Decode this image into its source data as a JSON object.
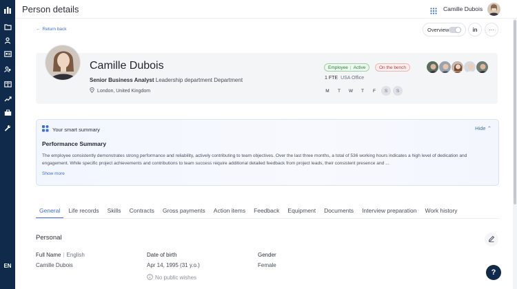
{
  "app": {
    "page_title": "Person details",
    "user_name": "Camille Dubois",
    "language": "EN"
  },
  "sidebar": {
    "icons": [
      "logo-icon",
      "folder-icon",
      "person-icon",
      "id-card-icon",
      "team-icon",
      "book-icon",
      "trend-icon",
      "briefcase-icon",
      "wrench-icon"
    ]
  },
  "header": {
    "return_label": "Return back",
    "overview_label": "Overview",
    "overview_on": false,
    "linkedin_label": "in",
    "more_label": "···"
  },
  "profile": {
    "name": "Camille Dubois",
    "title": "Senior Business Analyst",
    "department": "Leadership department Department",
    "location": "London, United Kingdom",
    "status_left": "Employee",
    "status_right": "Active",
    "bench_label": "On the bench",
    "fte": "1 FTE",
    "office": "USA Office",
    "days": [
      {
        "label": "M",
        "off": false
      },
      {
        "label": "T",
        "off": false
      },
      {
        "label": "W",
        "off": false
      },
      {
        "label": "T",
        "off": false
      },
      {
        "label": "F",
        "off": false
      },
      {
        "label": "S",
        "off": true
      },
      {
        "label": "S",
        "off": true
      }
    ]
  },
  "summary": {
    "header": "Your smart summary",
    "hide_label": "Hide",
    "title": "Performance Summary",
    "text": "The employee consistently demonstrates strong performance and reliability, actively contributing to team objectives. Over the last three months, a total of 536 working hours indicates a high level of dedication and engagement. While specific project achievements and contributions to team success require additional detailed feedback from project leads, their consistent presence and ...",
    "show_more": "Show more"
  },
  "tabs": [
    {
      "label": "General",
      "active": true
    },
    {
      "label": "Life records",
      "active": false
    },
    {
      "label": "Skills",
      "active": false
    },
    {
      "label": "Contracts",
      "active": false
    },
    {
      "label": "Gross payments",
      "active": false
    },
    {
      "label": "Action items",
      "active": false
    },
    {
      "label": "Feedback",
      "active": false
    },
    {
      "label": "Equipment",
      "active": false
    },
    {
      "label": "Documents",
      "active": false
    },
    {
      "label": "Interview preparation",
      "active": false
    },
    {
      "label": "Work history",
      "active": false
    }
  ],
  "personal": {
    "section_title": "Personal",
    "full_name_label": "Full Name",
    "full_name_lang": "English",
    "full_name_value": "Camille Dubois",
    "dob_label": "Date of birth",
    "dob_value": "Apr 14, 1995 (31 y.o.)",
    "wishes": "No public wishes",
    "gender_label": "Gender",
    "gender_value": "Female"
  },
  "colors": {
    "sidebar": "#0f2a4a",
    "accent": "#3a6fd8",
    "active_badge": "#2f7a3d",
    "bench_badge": "#b0443f"
  }
}
